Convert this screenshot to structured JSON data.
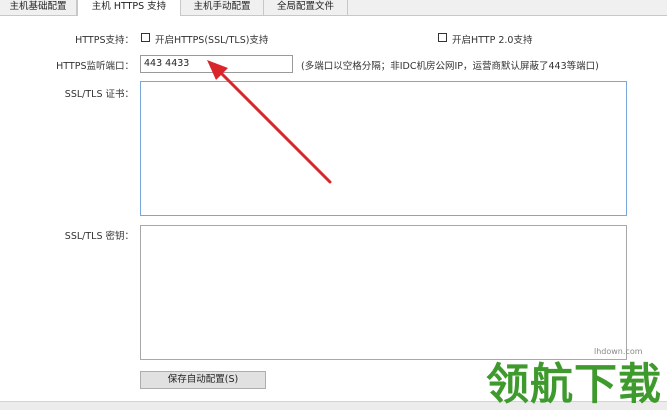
{
  "tabs": [
    {
      "label": "主机基础配置",
      "active": false
    },
    {
      "label": "主机 HTTPS 支持",
      "active": true
    },
    {
      "label": "主机手动配置",
      "active": false
    },
    {
      "label": "全局配置文件",
      "active": false
    }
  ],
  "form": {
    "https_support_label": "HTTPS支持：",
    "enable_https_label": "开启HTTPS(SSL/TLS)支持",
    "enable_http2_label": "开启HTTP 2.0支持",
    "https_port_label": "HTTPS监听端口：",
    "https_port_value": "443 4433",
    "https_port_hint": "(多端口以空格分隔；非IDC机房公网IP，运营商默认屏蔽了443等端口)",
    "ssl_cert_label": "SSL/TLS 证书：",
    "ssl_key_label": "SSL/TLS 密钥：",
    "save_button_label": "保存自动配置(S)"
  },
  "watermark": {
    "text": "领航下载",
    "url": "lhdown.com"
  },
  "colors": {
    "arrow": "#d9262b",
    "watermark": "#3f9a2e",
    "focus_border": "#7aa7d9"
  }
}
